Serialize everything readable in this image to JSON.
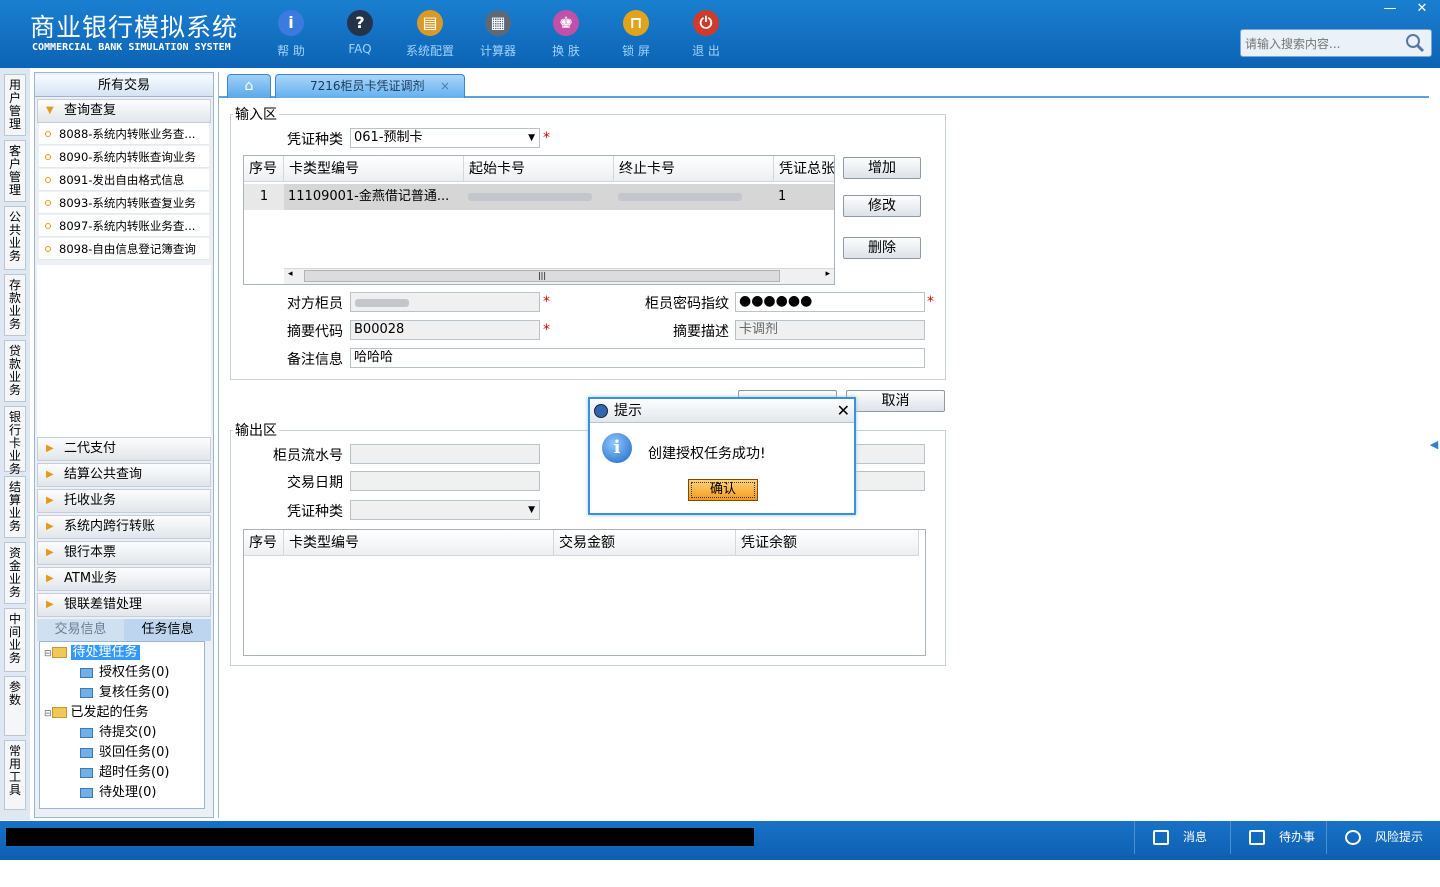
{
  "app": {
    "title_cn": "商业银行模拟系统",
    "title_en": "COMMERCIAL BANK SIMULATION SYSTEM",
    "toolbar": [
      {
        "label": "帮 助",
        "icon": "info-icon",
        "glyph": "i",
        "color": "#3b7be0"
      },
      {
        "label": "FAQ",
        "icon": "faq-icon",
        "glyph": "?",
        "color": "#24324a"
      },
      {
        "label": "系统配置",
        "icon": "toolbox-icon",
        "glyph": "▤",
        "color": "#d89a2a"
      },
      {
        "label": "计算器",
        "icon": "calculator-icon",
        "glyph": "▦",
        "color": "#5c6a78"
      },
      {
        "label": "换 肤",
        "icon": "shirt-icon",
        "glyph": "♚",
        "color": "#c24fa8"
      },
      {
        "label": "锁 屏",
        "icon": "lock-icon",
        "glyph": "⊓",
        "color": "#e0a41c"
      },
      {
        "label": "退 出",
        "icon": "power-icon",
        "glyph": "⏻",
        "color": "#d03a2a"
      }
    ],
    "search_placeholder": "请输入搜索内容...",
    "window_min": "—",
    "window_close": "✕"
  },
  "vtabs": [
    "用户管理",
    "客户管理",
    "公共业务",
    "存款业务",
    "贷款业务",
    "银行卡业务",
    "结算业务",
    "资金业务",
    "中间业务",
    "参数",
    "常用工具"
  ],
  "nav": {
    "all": "所有交易",
    "query_group": "查询查复",
    "query_items": [
      "8088-系统内转账业务查...",
      "8090-系统内转账查询业务",
      "8091-发出自由格式信息",
      "8093-系统内转账查复业务",
      "8097-系统内转账业务查...",
      "8098-自由信息登记簿查询"
    ],
    "groups": [
      "二代支付",
      "结算公共查询",
      "托收业务",
      "系统内跨行转账",
      "银行本票",
      "ATM业务",
      "银联差错处理"
    ],
    "bottom_tabs": [
      "交易信息",
      "任务信息"
    ],
    "tree": {
      "pending": "待处理任务",
      "auth": "授权任务(0)",
      "review": "复核任务(0)",
      "initiated": "已发起的任务",
      "to_submit": "待提交(0)",
      "rejected": "驳回任务(0)",
      "timeout": "超时任务(0)",
      "to_process": "待处理(0)"
    }
  },
  "tabs": {
    "home_icon": "⌂",
    "active": "7216柜员卡凭证调剂",
    "close": "×"
  },
  "input_area": {
    "title": "输入区",
    "voucher_type_label": "凭证种类",
    "voucher_type_value": "061-预制卡",
    "grid_headers": [
      "序号",
      "卡类型编号",
      "起始卡号",
      "终止卡号",
      "凭证总张数"
    ],
    "grid_row": {
      "no": "1",
      "card_type": "11109001-金燕借记普通...",
      "count": "1"
    },
    "btn_add": "增加",
    "btn_edit": "修改",
    "btn_delete": "删除",
    "counterpart_teller_label": "对方柜员",
    "pwd_label": "柜员密码指纹",
    "pwd_value": "●●●●●●",
    "summary_code_label": "摘要代码",
    "summary_code_value": "B00028",
    "summary_desc_label": "摘要描述",
    "summary_desc_value": "卡调剂",
    "remark_label": "备注信息",
    "remark_value": "哈哈哈",
    "required_mark": "*",
    "scroll_left": "◂",
    "scroll_right": "▸",
    "scroll_grip": "|||"
  },
  "actions": {
    "cancel": "取消"
  },
  "output_area": {
    "title": "输出区",
    "serial_label": "柜员流水号",
    "date_label": "交易日期",
    "voucher_type_label": "凭证种类",
    "grid_headers": [
      "序号",
      "卡类型编号",
      "交易金额",
      "凭证余额"
    ]
  },
  "dialog": {
    "title": "提示",
    "message": "创建授权任务成功!",
    "ok": "确认",
    "close": "✕",
    "icon_glyph": "i"
  },
  "statusbar": {
    "messages": "消息",
    "todo": "待办事项",
    "risk": "风险提示"
  }
}
